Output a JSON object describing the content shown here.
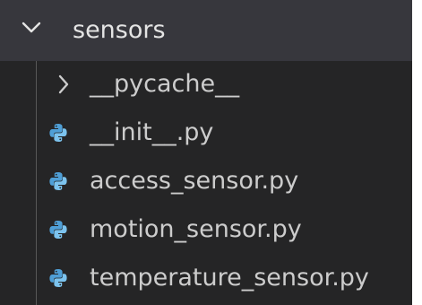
{
  "explorer": {
    "folder": {
      "label": "sensors",
      "state": "expanded",
      "icon": "chevron-down-icon"
    },
    "items": [
      {
        "label": "__pycache__",
        "type": "folder",
        "icon": "chevron-right-icon"
      },
      {
        "label": "__init__.py",
        "type": "file",
        "icon": "python-icon"
      },
      {
        "label": "access_sensor.py",
        "type": "file",
        "icon": "python-icon"
      },
      {
        "label": "motion_sensor.py",
        "type": "file",
        "icon": "python-icon"
      },
      {
        "label": "temperature_sensor.py",
        "type": "file",
        "icon": "python-icon"
      }
    ],
    "colors": {
      "background": "#252526",
      "selected_row": "#37373d",
      "text": "#cccccc",
      "python_icon_blue": "#4f9fd6",
      "python_icon_light": "#7cc3ee"
    }
  }
}
